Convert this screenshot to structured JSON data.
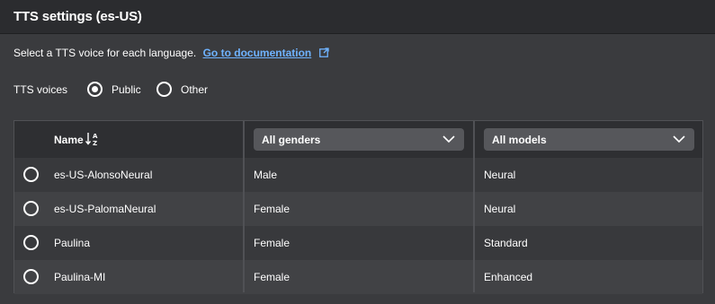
{
  "header": {
    "title": "TTS settings (es-US)"
  },
  "description": {
    "text": "Select a TTS voice for each language.",
    "link_label": "Go to documentation",
    "link_icon": "external-link-icon"
  },
  "voices": {
    "label": "TTS voices",
    "options": [
      {
        "label": "Public",
        "selected": true
      },
      {
        "label": "Other",
        "selected": false
      }
    ]
  },
  "table": {
    "columns": {
      "name": "Name",
      "name_sort_icon": "sort-alpha-down-icon",
      "gender_filter": "All genders",
      "model_filter": "All models"
    },
    "rows": [
      {
        "name": "es-US-AlonsoNeural",
        "gender": "Male",
        "model": "Neural",
        "selected": false
      },
      {
        "name": "es-US-PalomaNeural",
        "gender": "Female",
        "model": "Neural",
        "selected": false
      },
      {
        "name": "Paulina",
        "gender": "Female",
        "model": "Standard",
        "selected": false
      },
      {
        "name": "Paulina-MI",
        "gender": "Female",
        "model": "Enhanced",
        "selected": false
      }
    ]
  },
  "colors": {
    "background": "#3a3b3e",
    "header": "#2b2c2f",
    "link": "#6fb3ff",
    "select": "#56575b"
  }
}
